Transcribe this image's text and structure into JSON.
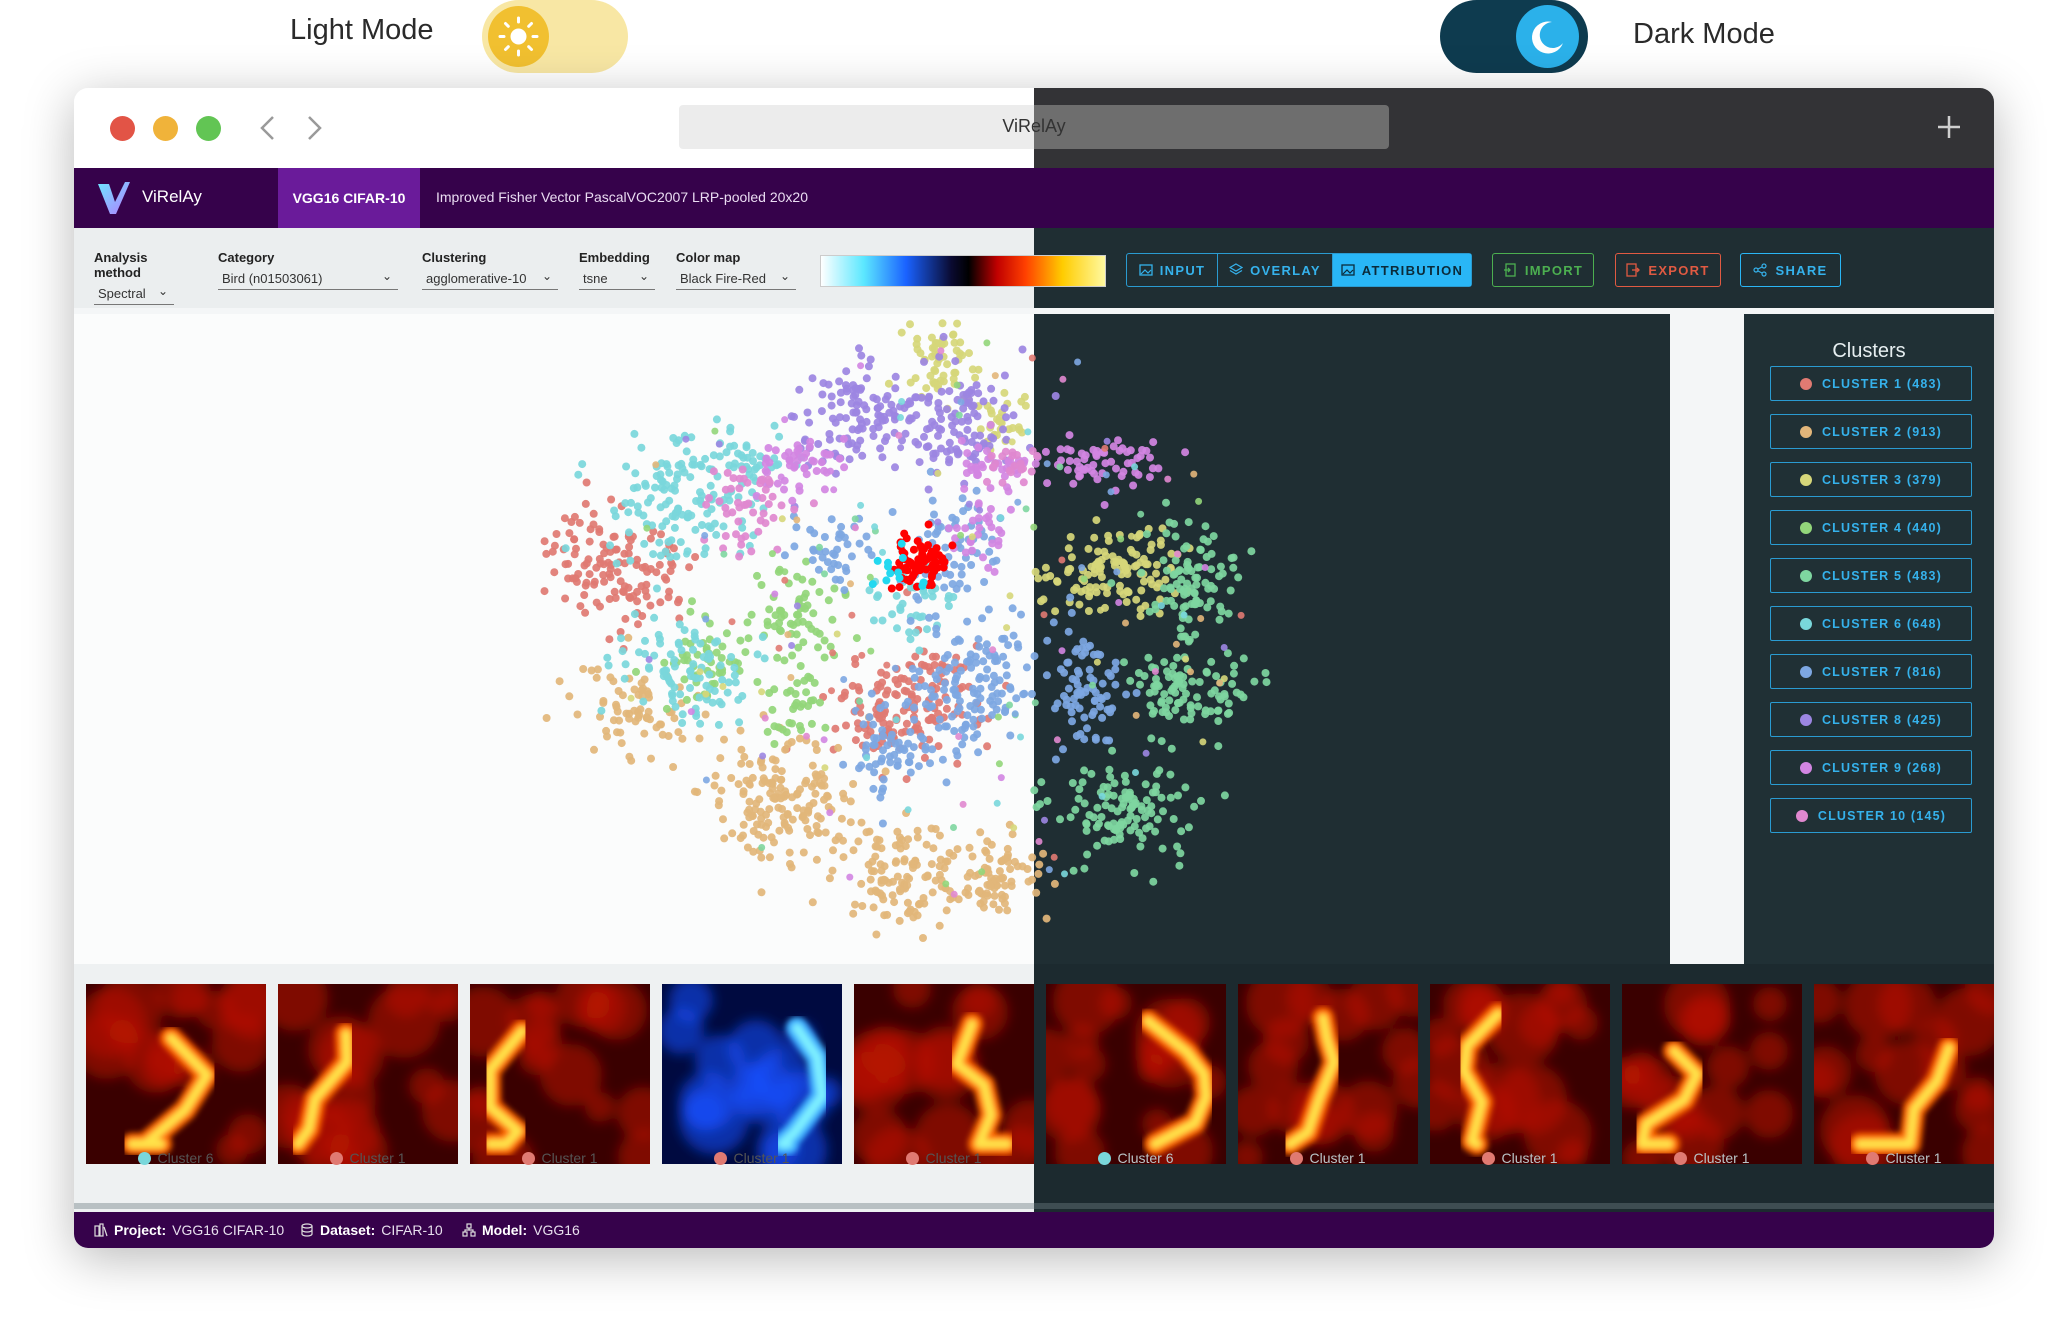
{
  "top": {
    "light_label": "Light Mode",
    "dark_label": "Dark Mode"
  },
  "window": {
    "url_title": "ViRelAy"
  },
  "appbar": {
    "brand": "ViRelAy",
    "project_tab": "VGG16 CIFAR-10",
    "analysis_tab": "Improved Fisher Vector PascalVOC2007 LRP-pooled 20x20"
  },
  "toolbar": {
    "analysis_method": {
      "label": "Analysis method",
      "value": "Spectral"
    },
    "category": {
      "label": "Category",
      "value": "Bird (n01503061)"
    },
    "clustering": {
      "label": "Clustering",
      "value": "agglomerative-10"
    },
    "embedding": {
      "label": "Embedding",
      "value": "tsne"
    },
    "color_map": {
      "label": "Color map",
      "value": "Black Fire-Red"
    },
    "view_buttons": [
      "INPUT",
      "OVERLAY",
      "ATTRIBUTION"
    ],
    "active_view": "ATTRIBUTION",
    "import_label": "IMPORT",
    "export_label": "EXPORT",
    "share_label": "SHARE"
  },
  "clusters_panel": {
    "title": "Clusters",
    "items": [
      {
        "label": "CLUSTER 1 (483)",
        "color": "#e07a72"
      },
      {
        "label": "CLUSTER 2 (913)",
        "color": "#e2b67a"
      },
      {
        "label": "CLUSTER 3 (379)",
        "color": "#d6d77a"
      },
      {
        "label": "CLUSTER 4 (440)",
        "color": "#92d67a"
      },
      {
        "label": "CLUSTER 5 (483)",
        "color": "#7ed6a0"
      },
      {
        "label": "CLUSTER 6 (648)",
        "color": "#79d7db"
      },
      {
        "label": "CLUSTER 7 (816)",
        "color": "#7da7e2"
      },
      {
        "label": "CLUSTER 8 (425)",
        "color": "#9c86e2"
      },
      {
        "label": "CLUSTER 9 (268)",
        "color": "#d285e2"
      },
      {
        "label": "CLUSTER 10 (145)",
        "color": "#e088cf"
      }
    ]
  },
  "thumbnails": [
    {
      "caption": "Cluster 6",
      "dot": "#79d7db",
      "colormap": "fire"
    },
    {
      "caption": "Cluster 1",
      "dot": "#e07a72",
      "colormap": "fire"
    },
    {
      "caption": "Cluster 1",
      "dot": "#e07a72",
      "colormap": "fire"
    },
    {
      "caption": "Cluster 1",
      "dot": "#e07a72",
      "colormap": "ice"
    },
    {
      "caption": "Cluster 1",
      "dot": "#e07a72",
      "colormap": "fire"
    },
    {
      "caption": "Cluster 6",
      "dot": "#79d7db",
      "colormap": "fire"
    },
    {
      "caption": "Cluster 1",
      "dot": "#e07a72",
      "colormap": "fire"
    },
    {
      "caption": "Cluster 1",
      "dot": "#e07a72",
      "colormap": "fire"
    },
    {
      "caption": "Cluster 1",
      "dot": "#e07a72",
      "colormap": "fire"
    },
    {
      "caption": "Cluster 1",
      "dot": "#e07a72",
      "colormap": "fire"
    }
  ],
  "footer": {
    "project_key": "Project:",
    "project_val": "VGG16 CIFAR-10",
    "dataset_key": "Dataset:",
    "dataset_val": "CIFAR-10",
    "model_key": "Model:",
    "model_val": "VGG16"
  },
  "colors": {
    "brand": "#36024b",
    "accent": "#29b6f6",
    "import": "#4caf50",
    "export": "#e05a42",
    "selected_points": "#ff0000"
  }
}
